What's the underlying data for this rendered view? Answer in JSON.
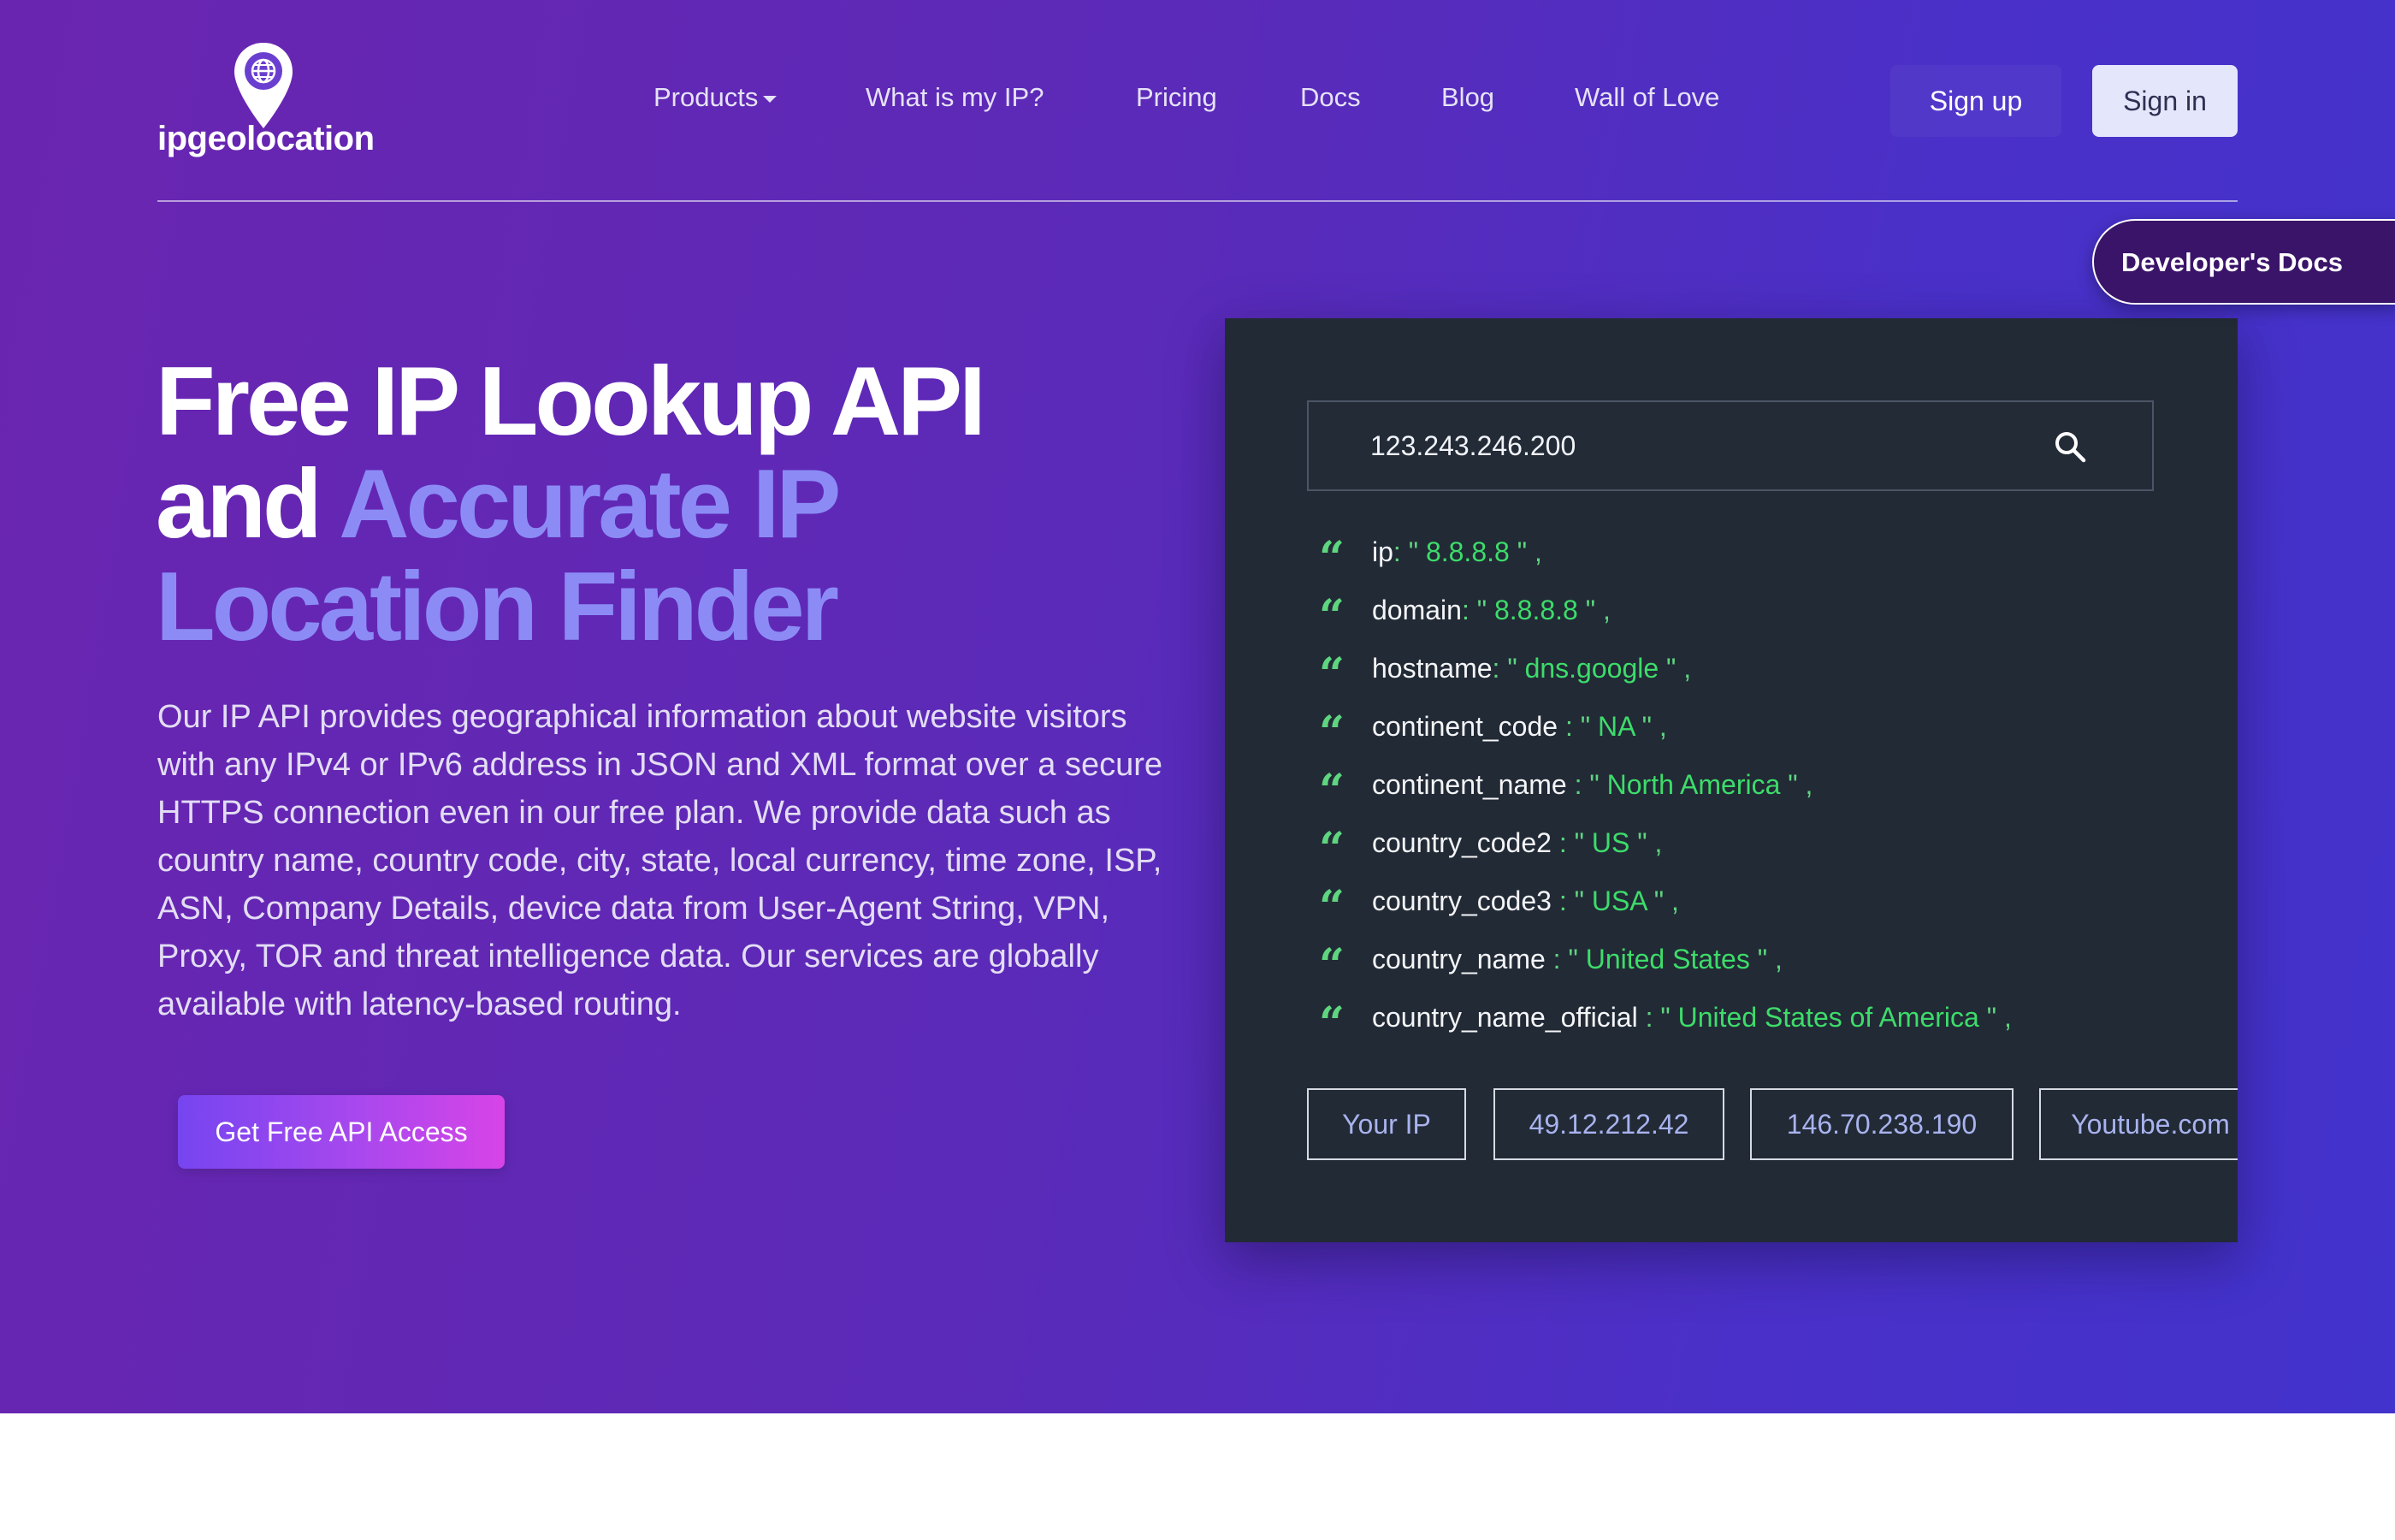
{
  "brand": {
    "logo_text": "ipgeolocation"
  },
  "nav": {
    "items": [
      {
        "label": "Products"
      },
      {
        "label": "What is my IP?"
      },
      {
        "label": "Pricing"
      },
      {
        "label": "Docs"
      },
      {
        "label": "Blog"
      },
      {
        "label": "Wall of Love"
      }
    ],
    "signup_label": "Sign up",
    "signin_label": "Sign in"
  },
  "dev_docs_label": "Developer's Docs",
  "hero": {
    "headline_line1": "Free IP Lookup API",
    "headline_and": "and",
    "headline_accent1": "Accurate IP",
    "headline_accent2": "Location Finder",
    "description": "Our IP API provides geographical information about website visitors with any IPv4 or IPv6 address in JSON and XML format over a secure HTTPS connection even in our free plan. We provide data such as country name, country code, city, state, local currency, time zone, ISP, ASN, Company Details, device data from User-Agent String, VPN, Proxy, TOR and threat intelligence data. Our services are globally available with latency-based routing.",
    "cta_label": "Get Free API Access"
  },
  "lookup": {
    "query_value": "123.243.246.200",
    "quote_glyph": "“",
    "fields": [
      {
        "key": "ip",
        "sep": ": \" ",
        "value": "8.8.8.8",
        "end": " \" ,"
      },
      {
        "key": "domain",
        "sep": ": \" ",
        "value": "8.8.8.8",
        "end": " \" ,"
      },
      {
        "key": "hostname",
        "sep": ": \" ",
        "value": "dns.google",
        "end": " \" ,"
      },
      {
        "key": "continent_code",
        "sep": " : \" ",
        "value": "NA",
        "end": " \" ,"
      },
      {
        "key": "continent_name",
        "sep": " : \" ",
        "value": "North America",
        "end": " \" ,"
      },
      {
        "key": "country_code2",
        "sep": " : \" ",
        "value": "US",
        "end": " \" ,"
      },
      {
        "key": "country_code3",
        "sep": " : \" ",
        "value": "USA",
        "end": " \" ,"
      },
      {
        "key": "country_name",
        "sep": " : \" ",
        "value": "United States",
        "end": " \" ,"
      },
      {
        "key": "country_name_official",
        "sep": " : \" ",
        "value": "United States of America",
        "end": " \" ,"
      }
    ],
    "chips": [
      {
        "label": "Your IP"
      },
      {
        "label": "49.12.212.42"
      },
      {
        "label": "146.70.238.190"
      },
      {
        "label": "Youtube.com"
      }
    ]
  },
  "colors": {
    "hero_gradient_start": "#6a25b0",
    "hero_gradient_end": "#4233cc",
    "accent_text": "#8c8bf6",
    "panel_bg": "#222a36",
    "json_value": "#3ddc6a",
    "signin_bg": "#e4e6fb"
  }
}
